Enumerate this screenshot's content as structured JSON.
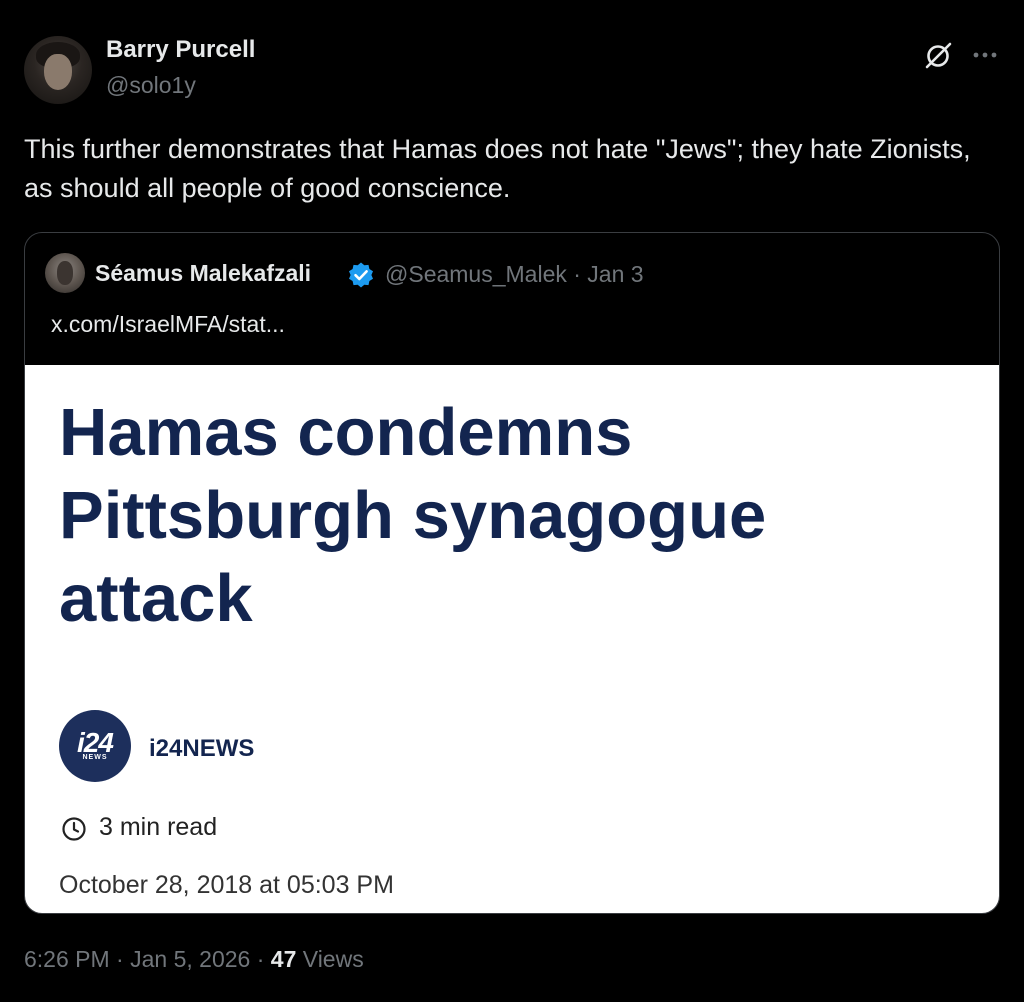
{
  "author": {
    "display_name": "Barry Purcell",
    "handle": "@solo1y"
  },
  "header_icons": [
    "grok-icon",
    "more-icon"
  ],
  "post": {
    "text": "This further demonstrates that Hamas does not hate \"Jews\"; they hate Zionists, as should all people of good conscience.",
    "time": "6:26 PM",
    "date": "Jan 5, 2026",
    "views_count": "47",
    "views_label": "Views"
  },
  "quote": {
    "display_name": "Séamus Malekafzali",
    "handle_date": "@Seamus_Malek · Jan 3",
    "link_text": "x.com/IsraelMFA/stat...",
    "article": {
      "headline": "Hamas condemns Pittsburgh synagogue attack",
      "source_logo_text": "i24",
      "source_logo_subtext": "NEWS",
      "source_name": "i24NEWS",
      "read_time": "3 min read",
      "date": "October 28, 2018 at 05:03 PM"
    }
  },
  "colors": {
    "background": "#000000",
    "text_primary": "#e7e9ea",
    "text_secondary": "#71767b",
    "verified_blue": "#1d9bf0",
    "headline_navy": "#13254f"
  }
}
